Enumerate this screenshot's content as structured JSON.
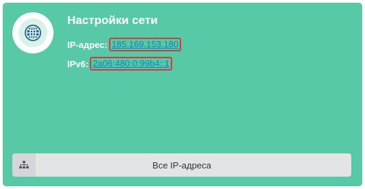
{
  "widget": {
    "title": "Настройки сети",
    "icon": "globe-icon"
  },
  "ipv4": {
    "label": "IP-адрес:",
    "value": "185.169.153.180"
  },
  "ipv6": {
    "label": "IPv6:",
    "value": "2a06:480:0:99b4::1"
  },
  "footer": {
    "button_label": "Все IP-адреса",
    "button_icon": "network-tree-icon"
  },
  "colors": {
    "card_background": "#57c9a6",
    "link": "#1a7fbf",
    "highlight_border": "#d43a3a",
    "button_background": "#e3e4e6"
  }
}
